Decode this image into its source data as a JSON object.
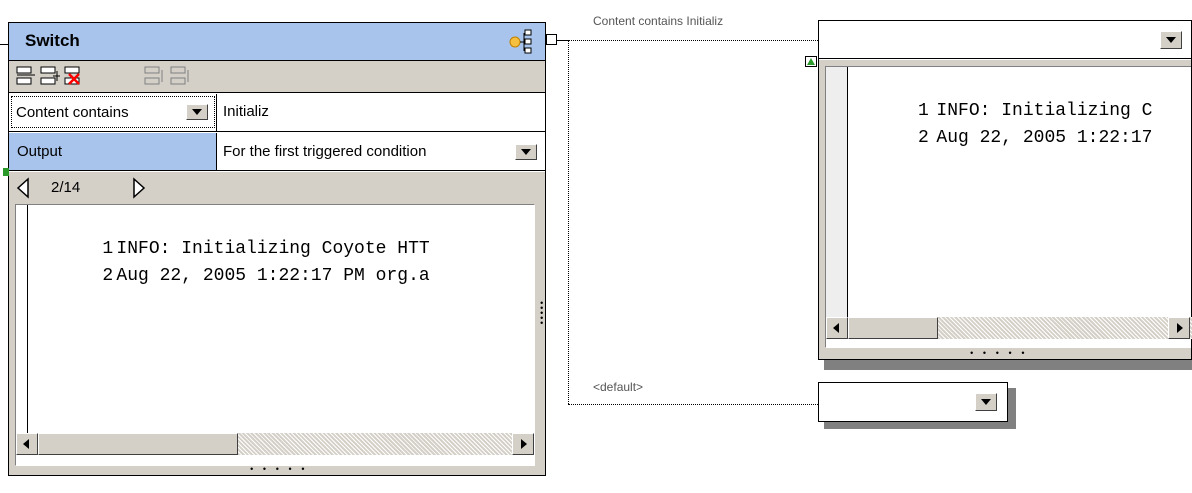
{
  "switch": {
    "title": "Switch",
    "condition_type": "Content contains",
    "condition_value": "Initializ",
    "output_label": "Output",
    "output_value": "For the first triggered condition",
    "pager": "2/14",
    "lines": [
      {
        "num": "1",
        "text": "INFO: Initializing Coyote HTT"
      },
      {
        "num": "2",
        "text": "Aug 22, 2005 1:22:17 PM org.a"
      }
    ]
  },
  "connectors": {
    "condition_label": "Content contains Initializ",
    "default_label": "<default>"
  },
  "output_panel": {
    "lines": [
      {
        "num": "1",
        "text": "INFO: Initializing C"
      },
      {
        "num": "2",
        "text": "Aug 22, 2005 1:22:17"
      }
    ]
  },
  "colors": {
    "title_bar": "#a8c4ec",
    "selected_row": "#a8c4ec",
    "frame_bg": "#d4d0c8",
    "error_red": "#ff0000"
  },
  "icons": [
    "switch-node-icon",
    "add-condition-icon",
    "insert-condition-icon",
    "delete-condition-icon",
    "move-up-icon",
    "move-down-icon",
    "previous-icon",
    "next-icon",
    "dropdown-icon",
    "scroll-left-icon",
    "scroll-right-icon",
    "collapse-icon"
  ]
}
